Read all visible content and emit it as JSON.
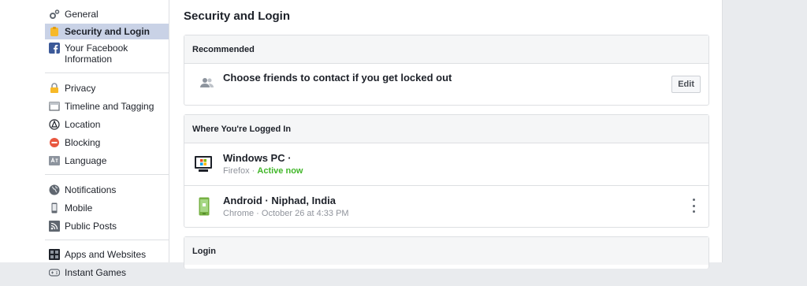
{
  "sidebar": {
    "groups": [
      [
        {
          "label": "General",
          "icon": "gears-icon"
        },
        {
          "label": "Security and Login",
          "icon": "badge-icon",
          "active": true
        },
        {
          "label": "Your Facebook Information",
          "icon": "facebook-icon"
        }
      ],
      [
        {
          "label": "Privacy",
          "icon": "lock-icon"
        },
        {
          "label": "Timeline and Tagging",
          "icon": "timeline-icon"
        },
        {
          "label": "Location",
          "icon": "location-icon"
        },
        {
          "label": "Blocking",
          "icon": "blocking-icon"
        },
        {
          "label": "Language",
          "icon": "language-icon"
        }
      ],
      [
        {
          "label": "Notifications",
          "icon": "globe-icon"
        },
        {
          "label": "Mobile",
          "icon": "mobile-icon"
        },
        {
          "label": "Public Posts",
          "icon": "rss-icon"
        }
      ],
      [
        {
          "label": "Apps and Websites",
          "icon": "apps-icon"
        },
        {
          "label": "Instant Games",
          "icon": "gamepad-icon"
        }
      ]
    ]
  },
  "main": {
    "title": "Security and Login",
    "recommended": {
      "header": "Recommended",
      "item_title": "Choose friends to contact if you get locked out",
      "edit_label": "Edit"
    },
    "logged_in": {
      "header": "Where You're Logged In",
      "sessions": [
        {
          "device": "Windows PC ·",
          "browser": "Firefox",
          "separator": " · ",
          "status": "Active now",
          "icon": "desktop-icon"
        },
        {
          "device": "Android · Niphad, India",
          "browser": "Chrome",
          "separator": " · ",
          "status": "October 26 at 4:33 PM",
          "icon": "android-phone-icon"
        }
      ]
    },
    "login": {
      "header": "Login"
    }
  },
  "colors": {
    "active_bg": "#c9d2e6",
    "active_green": "#42b72a",
    "facebook_blue": "#3b5998"
  }
}
